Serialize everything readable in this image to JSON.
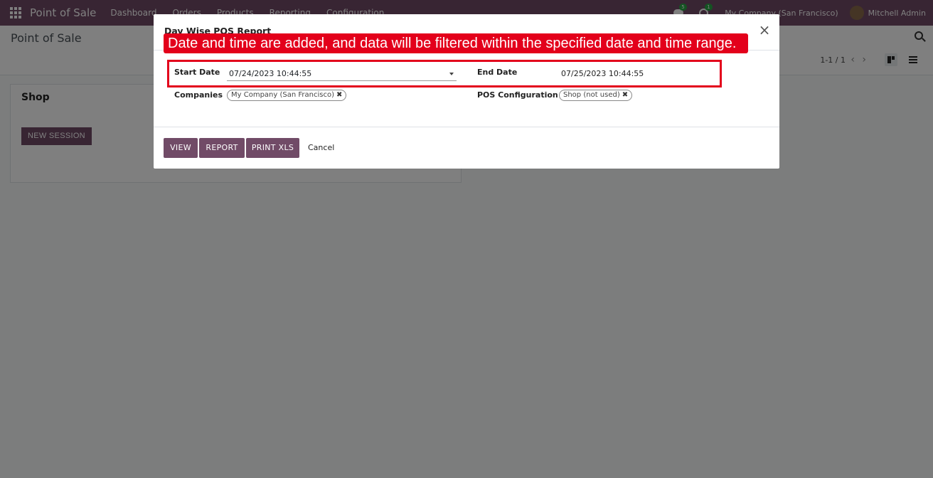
{
  "navbar": {
    "brand": "Point of Sale",
    "menu": [
      "Dashboard",
      "Orders",
      "Products",
      "Reporting",
      "Configuration"
    ],
    "chat_badge": "5",
    "activity_badge": "1",
    "company": "My Company (San Francisco)",
    "user": "Mitchell Admin"
  },
  "control_panel": {
    "breadcrumb": "Point of Sale",
    "pager": "1-1 / 1"
  },
  "card": {
    "title": "Shop",
    "new_session_label": "NEW SESSION"
  },
  "modal": {
    "title": "Day Wise POS Report",
    "annotation": "Date and time are added, and data will be filtered within the specified date and time range.",
    "start_date_label": "Start Date",
    "start_date_value": "07/24/2023 10:44:55",
    "end_date_label": "End Date",
    "end_date_value": "07/25/2023 10:44:55",
    "companies_label": "Companies",
    "company_tag": "My Company (San Francisco)",
    "pos_config_label": "POS Configuration",
    "pos_config_tag": "Shop (not used)",
    "buttons": {
      "view": "VIEW",
      "report": "REPORT",
      "print_xls": "PRINT XLS",
      "cancel": "Cancel"
    }
  },
  "colors": {
    "brand": "#714b67",
    "annotation": "#e3001b"
  }
}
